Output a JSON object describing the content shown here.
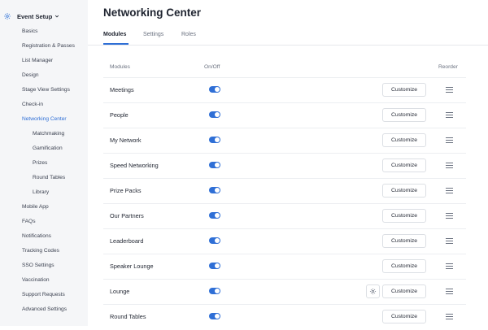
{
  "sidebar": {
    "header": "Event Setup",
    "items": [
      {
        "label": "Basics"
      },
      {
        "label": "Registration & Passes"
      },
      {
        "label": "List Manager"
      },
      {
        "label": "Design"
      },
      {
        "label": "Stage View Settings"
      },
      {
        "label": "Check-in"
      },
      {
        "label": "Networking Center",
        "active": true
      },
      {
        "label": "Matchmaking"
      },
      {
        "label": "Gamification"
      },
      {
        "label": "Prizes"
      },
      {
        "label": "Round Tables"
      },
      {
        "label": "Library"
      },
      {
        "label": "Mobile App"
      },
      {
        "label": "FAQs"
      },
      {
        "label": "Notifications"
      },
      {
        "label": "Tracking Codes"
      },
      {
        "label": "SSO Settings"
      },
      {
        "label": "Vaccination"
      },
      {
        "label": "Support Requests"
      },
      {
        "label": "Advanced Settings"
      }
    ]
  },
  "page_title": "Networking Center",
  "tabs": [
    "Modules",
    "Settings",
    "Roles"
  ],
  "table": {
    "headers": {
      "modules": "Modules",
      "onoff": "On/Off",
      "reorder": "Reorder"
    },
    "customize_label": "Customize",
    "rows": [
      {
        "name": "Meetings",
        "on": true
      },
      {
        "name": "People",
        "on": true
      },
      {
        "name": "My Network",
        "on": true
      },
      {
        "name": "Speed Networking",
        "on": true
      },
      {
        "name": "Prize Packs",
        "on": true
      },
      {
        "name": "Our Partners",
        "on": true
      },
      {
        "name": "Leaderboard",
        "on": true
      },
      {
        "name": "Speaker Lounge",
        "on": true
      },
      {
        "name": "Lounge",
        "on": true,
        "settings_icon": "gear-icon"
      },
      {
        "name": "Round Tables",
        "on": true
      }
    ]
  },
  "colors": {
    "accent": "#2f6fd6",
    "sidebar_bg": "#f5f6f8"
  }
}
